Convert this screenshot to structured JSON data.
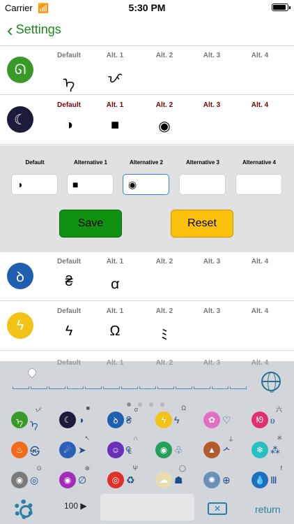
{
  "status": {
    "carrier": "Carrier",
    "time": "5:30 PM"
  },
  "nav": {
    "back_label": "Settings"
  },
  "rows": [
    {
      "headers": [
        "Default",
        "Alt. 1",
        "Alt. 2",
        "Alt. 3",
        "Alt. 4"
      ],
      "symbols": [
        "ᡝ",
        "ᜉ",
        "",
        "",
        ""
      ],
      "logo_color": "#3a9a28",
      "logo_glyph": "ᘏ"
    },
    {
      "headers": [
        "Default",
        "Alt. 1",
        "Alt. 2",
        "Alt. 3",
        "Alt. 4"
      ],
      "symbols": [
        "◑",
        "■",
        "◉",
        "",
        ""
      ],
      "logo_color": "#1c1c3a",
      "logo_glyph": "☾"
    },
    {
      "headers": [
        "Default",
        "Alt. 1",
        "Alt. 2",
        "Alt. 3",
        "Alt. 4"
      ],
      "symbols": [
        "₴",
        "ꭤ",
        "",
        "",
        ""
      ],
      "logo_color": "#1f5fb0",
      "logo_glyph": "ꝺ"
    },
    {
      "headers": [
        "Default",
        "Alt. 1",
        "Alt. 2",
        "Alt. 3",
        "Alt. 4"
      ],
      "symbols": [
        "ϟ",
        "Ω",
        "ﾐ",
        "",
        ""
      ],
      "logo_color": "#f2c316",
      "logo_glyph": "ϟ"
    }
  ],
  "partial_row_headers": [
    "Default",
    "Alt. 1",
    "Alt. 2",
    "Alt. 3",
    "Alt. 4"
  ],
  "editor": {
    "labels": [
      "Default",
      "Alternative 1",
      "Alternative 2",
      "Alternative 3",
      "Alternative 4"
    ],
    "values": [
      "◑",
      "■",
      "◉",
      "",
      ""
    ],
    "save_label": "Save",
    "reset_label": "Reset"
  },
  "keyboard": {
    "keys": [
      [
        "ᡝ",
        "#3a9a28",
        "ᜉ",
        "ᡝ",
        "ᡝ"
      ],
      [
        "◑",
        "#1c1c3a",
        "■",
        "☾",
        "◑"
      ],
      [
        "₴",
        "#1f5fb0",
        "ꭤ",
        "ꝺ",
        "₴"
      ],
      [
        "ϟ",
        "#f2c316",
        "Ω",
        "ϟ",
        "ϟ"
      ],
      [
        "♡",
        "#e06fc0",
        "",
        "✿",
        "♡"
      ],
      [
        "ᦈ",
        "#e0306f",
        "六",
        "ᘚ",
        "ᦈ"
      ],
      [
        "㉿",
        "#f06a18",
        "",
        "♨",
        "㉿"
      ],
      [
        "➤",
        "#2a5fb8",
        "↖",
        "☄",
        "➤"
      ],
      [
        "₠",
        "#6a2fb8",
        "∩",
        "☺",
        "₠"
      ],
      [
        "♧",
        "#22a05a",
        "",
        "◉",
        "♧"
      ],
      [
        "ᄼ",
        "#b35b2a",
        "⏚",
        "▲",
        "ᄼ"
      ],
      [
        "⁂",
        "#25c0c0",
        "※",
        "❄",
        "⁂"
      ],
      [
        "◎",
        "#7a7a7a",
        "⊙",
        "◉",
        "◎"
      ],
      [
        "∅",
        "#a42ab8",
        "⊗",
        "◉",
        "∅"
      ],
      [
        "♻",
        "#e0302a",
        "Ψ",
        "◎",
        "♻"
      ],
      [
        "☗",
        "#e8dcb0",
        "◯",
        "☁",
        "☗"
      ],
      [
        "⊕",
        "#6a8fb8",
        "",
        "✺",
        "⊕"
      ],
      [
        "Ⅲ",
        "#1f6fc0",
        "f",
        "💧",
        "Ⅲ"
      ]
    ],
    "num_label": "100",
    "return_label": "return",
    "delete_glyph": "✕"
  }
}
